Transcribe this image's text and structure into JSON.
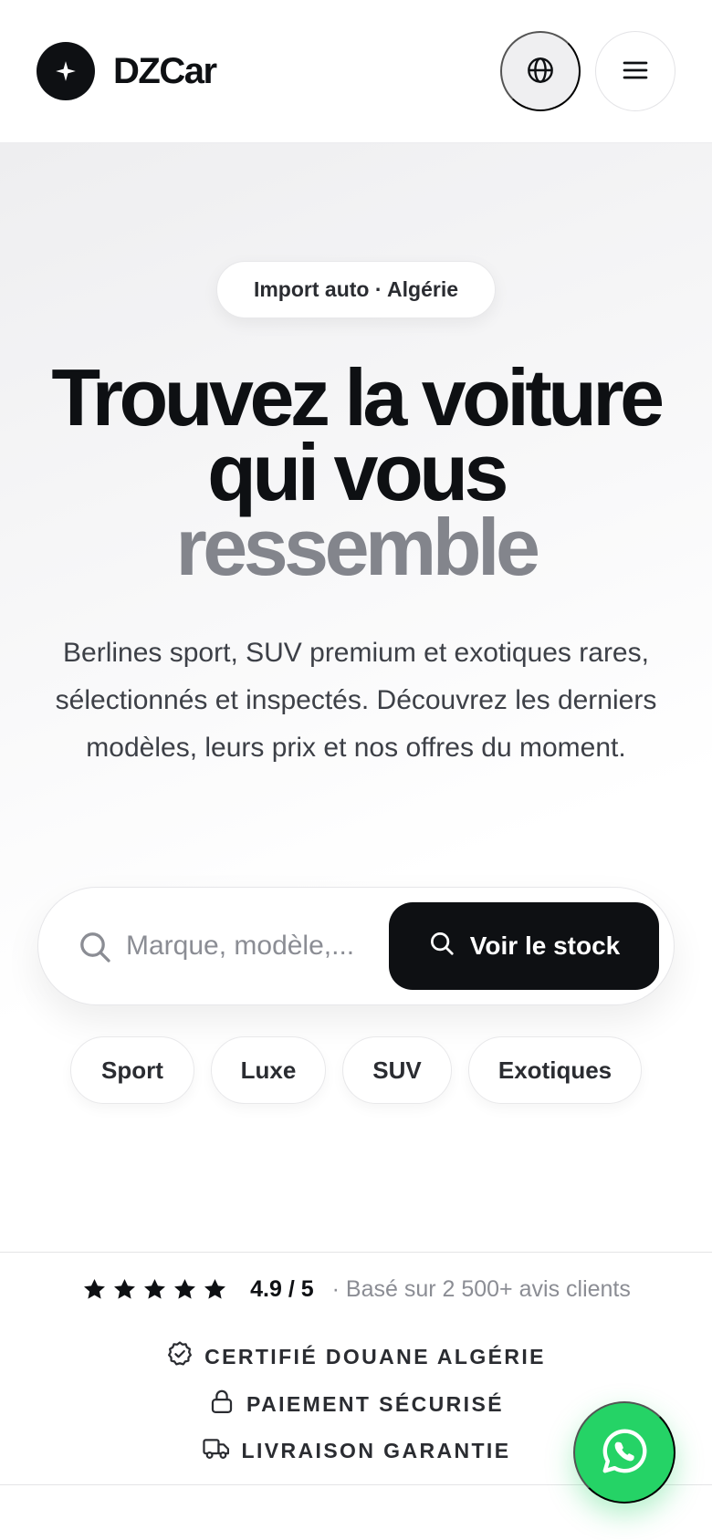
{
  "header": {
    "brand": "DZCar",
    "language_icon": "globe-icon",
    "menu_icon": "hamburger-menu-icon"
  },
  "hero": {
    "pill": "Import auto · Algérie",
    "headline_line1": "Trouvez la voiture",
    "headline_line2": "qui vous",
    "headline_line3": "ressemble",
    "subtitle": "Berlines sport, SUV premium et exotiques rares, sélectionnés et inspectés. Découvrez les derniers modèles, leurs prix et nos offres du moment.",
    "search": {
      "placeholder": "Marque, modèle,...",
      "value": "",
      "button_label": "Voir le stock"
    },
    "chips": [
      "Sport",
      "Luxe",
      "SUV",
      "Exotiques"
    ]
  },
  "trust": {
    "stars": 5,
    "score": "4.9 / 5",
    "reviews": "· Basé sur 2 500+ avis clients",
    "badges": [
      {
        "icon": "verified-badge-icon",
        "label": "CERTIFIÉ DOUANE ALGÉRIE"
      },
      {
        "icon": "lock-icon",
        "label": "PAIEMENT SÉCURISÉ"
      },
      {
        "icon": "truck-icon",
        "label": "LIVRAISON GARANTIE"
      }
    ]
  },
  "floating": {
    "whatsapp_icon": "whatsapp-icon"
  },
  "colors": {
    "ink": "#0e1013",
    "muted_headline": "#83858c",
    "whatsapp_green": "#25d366"
  }
}
